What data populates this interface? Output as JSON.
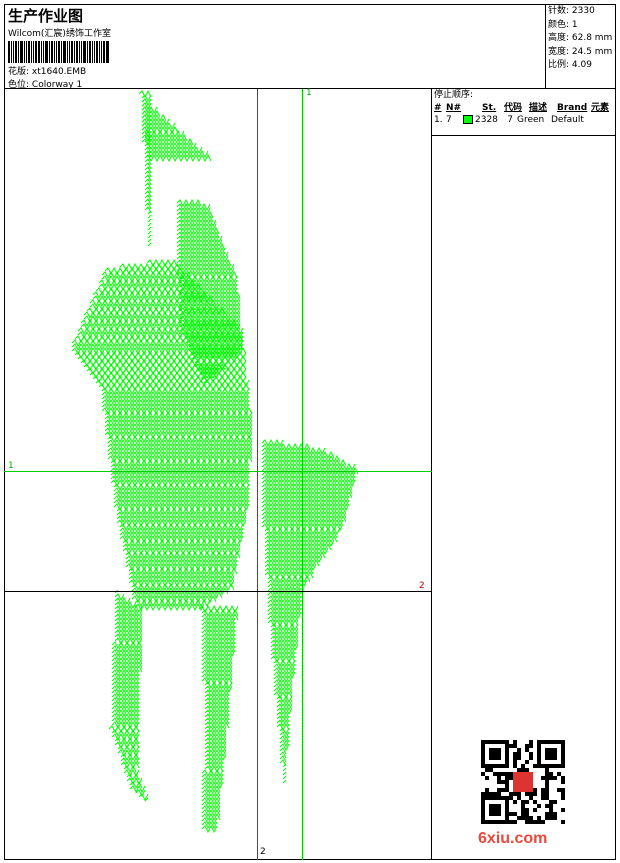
{
  "header": {
    "title": "生产作业图",
    "company": "Wilcom(汇宸)绣饰工作室",
    "design_label": "花版:",
    "design_value": "xt1640.EMB",
    "colorway_label": "色位:",
    "colorway_value": "Colorway 1"
  },
  "info": {
    "stitches": "针数: 2330",
    "colors": "颜色: 1",
    "height": "高度: 62.8 mm",
    "width": "宽度: 24.5 mm",
    "scale": "比例: 4.09"
  },
  "stop_sequence": {
    "title": "停止顺序:",
    "columns": [
      "#",
      "N#",
      "St.",
      "代码",
      "描述",
      "Brand",
      "元素"
    ],
    "rows": [
      {
        "num": "1.",
        "n": "7",
        "swatch": "#00ff00",
        "st": "2328",
        "code": "7",
        "desc": "Green",
        "brand": "Default"
      }
    ]
  },
  "guides": {
    "v_green": "1",
    "v_red": "2",
    "h_green": "1",
    "h_red": "2"
  },
  "colors": {
    "stitch": "#00ff00",
    "red_guide": "#ff0000",
    "green_guide": "#00cc00"
  },
  "watermark": "6xiu.com"
}
